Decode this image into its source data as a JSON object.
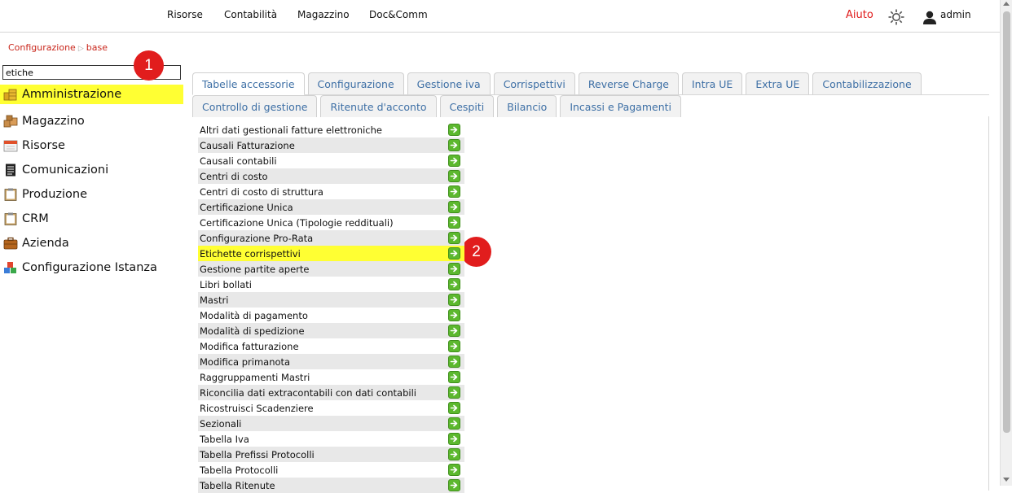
{
  "topnav": {
    "items": [
      "Risorse",
      "Contabilità",
      "Magazzino",
      "Doc&Comm"
    ],
    "help_label": "Aiuto",
    "user_label": "admin"
  },
  "breadcrumb": {
    "first": "Configurazione",
    "second": "base"
  },
  "search": {
    "value": "etiche"
  },
  "badges": {
    "one": "1",
    "two": "2"
  },
  "tree": [
    {
      "label": "Amministrazione",
      "icon": "coins-icon"
    },
    {
      "label": "Magazzino",
      "icon": "boxes-icon"
    },
    {
      "label": "Risorse",
      "icon": "calendar-icon"
    },
    {
      "label": "Comunicazioni",
      "icon": "document-icon"
    },
    {
      "label": "Produzione",
      "icon": "clipboard-icon"
    },
    {
      "label": "CRM",
      "icon": "clipboard-icon"
    },
    {
      "label": "Azienda",
      "icon": "briefcase-icon"
    },
    {
      "label": "Configurazione Istanza",
      "icon": "blocks-icon"
    }
  ],
  "tabs_row1": [
    "Tabelle accessorie",
    "Configurazione",
    "Gestione iva",
    "Corrispettivi",
    "Reverse Charge",
    "Intra UE",
    "Extra UE",
    "Contabilizzazione"
  ],
  "tabs_row2": [
    "Controllo di gestione",
    "Ritenute d'acconto",
    "Cespiti",
    "Bilancio",
    "Incassi e Pagamenti"
  ],
  "list": [
    "Altri dati gestionali fatture elettroniche",
    "Causali Fatturazione",
    "Causali contabili",
    "Centri di costo",
    "Centri di costo di struttura",
    "Certificazione Unica",
    "Certificazione Unica (Tipologie reddituali)",
    "Configurazione Pro-Rata",
    "Etichette corrispettivi",
    "Gestione partite aperte",
    "Libri bollati",
    "Mastri",
    "Modalità di pagamento",
    "Modalità di spedizione",
    "Modifica fatturazione",
    "Modifica primanota",
    "Raggruppamenti Mastri",
    "Riconcilia dati extracontabili con dati contabili",
    "Ricostruisci Scadenziere",
    "Sezionali",
    "Tabella Iva",
    "Tabella Prefissi Protocolli",
    "Tabella Protocolli",
    "Tabella Ritenute"
  ],
  "colors": {
    "highlight": "#ffff33",
    "accent_red": "#e11d1d",
    "tab_text": "#3d6fa5",
    "go_green": "#5cb82e"
  }
}
